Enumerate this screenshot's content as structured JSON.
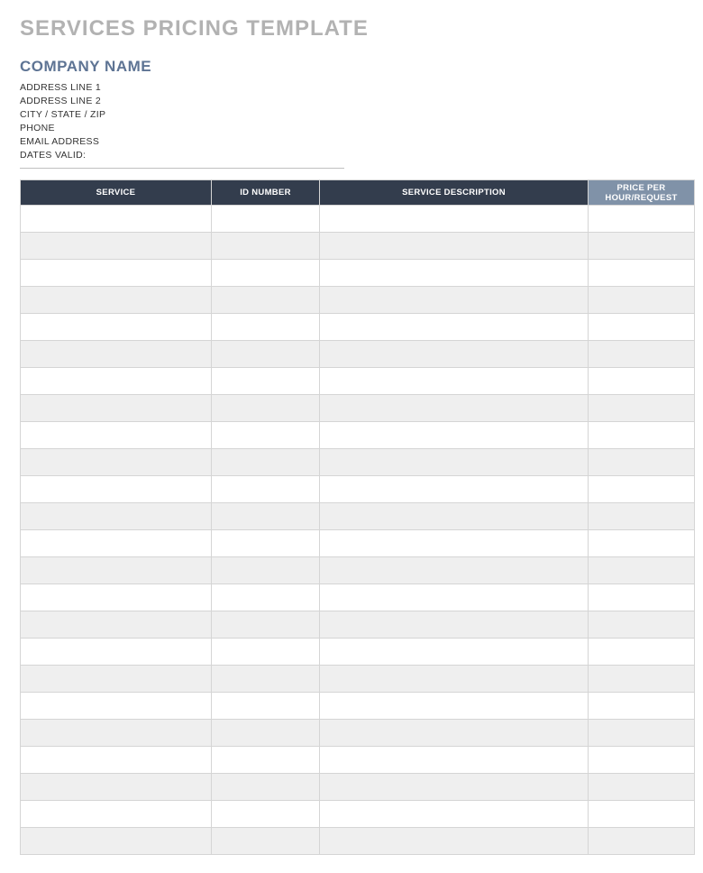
{
  "title": "SERVICES PRICING TEMPLATE",
  "company": {
    "name": "COMPANY NAME",
    "address1": "ADDRESS LINE 1",
    "address2": "ADDRESS LINE 2",
    "city_state_zip": "CITY / STATE / ZIP",
    "phone": "PHONE",
    "email": "EMAIL ADDRESS",
    "dates_valid": "DATES VALID:"
  },
  "table": {
    "headers": {
      "service": "SERVICE",
      "id_number": "ID NUMBER",
      "description": "SERVICE DESCRIPTION",
      "price": "PRICE PER HOUR/REQUEST"
    },
    "rows": [
      {
        "service": "",
        "id_number": "",
        "description": "",
        "price": ""
      },
      {
        "service": "",
        "id_number": "",
        "description": "",
        "price": ""
      },
      {
        "service": "",
        "id_number": "",
        "description": "",
        "price": ""
      },
      {
        "service": "",
        "id_number": "",
        "description": "",
        "price": ""
      },
      {
        "service": "",
        "id_number": "",
        "description": "",
        "price": ""
      },
      {
        "service": "",
        "id_number": "",
        "description": "",
        "price": ""
      },
      {
        "service": "",
        "id_number": "",
        "description": "",
        "price": ""
      },
      {
        "service": "",
        "id_number": "",
        "description": "",
        "price": ""
      },
      {
        "service": "",
        "id_number": "",
        "description": "",
        "price": ""
      },
      {
        "service": "",
        "id_number": "",
        "description": "",
        "price": ""
      },
      {
        "service": "",
        "id_number": "",
        "description": "",
        "price": ""
      },
      {
        "service": "",
        "id_number": "",
        "description": "",
        "price": ""
      },
      {
        "service": "",
        "id_number": "",
        "description": "",
        "price": ""
      },
      {
        "service": "",
        "id_number": "",
        "description": "",
        "price": ""
      },
      {
        "service": "",
        "id_number": "",
        "description": "",
        "price": ""
      },
      {
        "service": "",
        "id_number": "",
        "description": "",
        "price": ""
      },
      {
        "service": "",
        "id_number": "",
        "description": "",
        "price": ""
      },
      {
        "service": "",
        "id_number": "",
        "description": "",
        "price": ""
      },
      {
        "service": "",
        "id_number": "",
        "description": "",
        "price": ""
      },
      {
        "service": "",
        "id_number": "",
        "description": "",
        "price": ""
      },
      {
        "service": "",
        "id_number": "",
        "description": "",
        "price": ""
      },
      {
        "service": "",
        "id_number": "",
        "description": "",
        "price": ""
      },
      {
        "service": "",
        "id_number": "",
        "description": "",
        "price": ""
      },
      {
        "service": "",
        "id_number": "",
        "description": "",
        "price": ""
      }
    ]
  }
}
